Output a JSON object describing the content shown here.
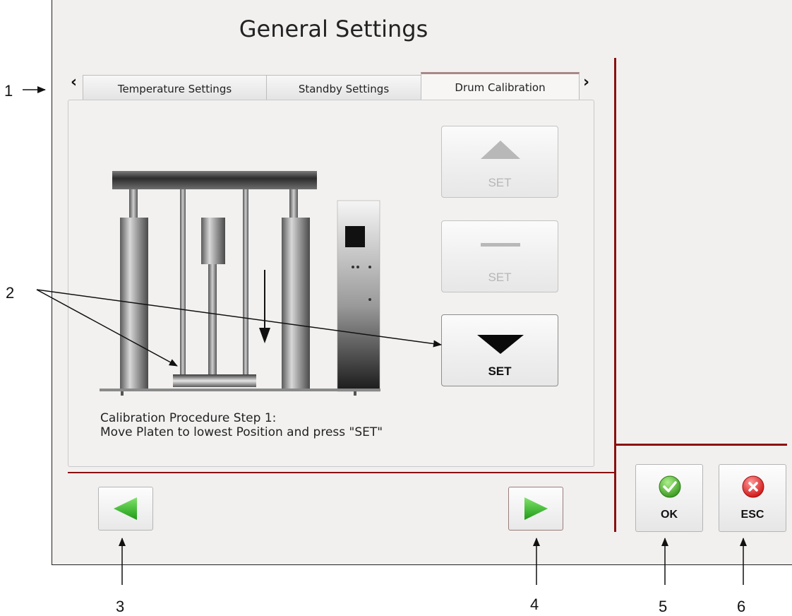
{
  "window": {
    "title": "General Settings"
  },
  "tabs": [
    {
      "label": "Temperature Settings",
      "active": false
    },
    {
      "label": "Standby Settings",
      "active": false
    },
    {
      "label": "Drum Calibration",
      "active": true
    }
  ],
  "set_buttons": {
    "up": {
      "label": "SET",
      "icon": "triangle-up-icon",
      "enabled": false
    },
    "middle": {
      "label": "SET",
      "icon": "minus-icon",
      "enabled": false
    },
    "down": {
      "label": "SET",
      "icon": "triangle-down-icon",
      "enabled": true
    }
  },
  "instruction": {
    "line1": "Calibration Procedure Step 1:",
    "line2": "Move Platen to lowest Position and press \"SET\""
  },
  "navigation": {
    "prev_icon": "arrow-left-icon",
    "next_icon": "arrow-right-icon"
  },
  "actions": {
    "ok": {
      "label": "OK",
      "icon": "check-circle-icon"
    },
    "esc": {
      "label": "ESC",
      "icon": "x-circle-icon"
    }
  },
  "callouts": [
    "1",
    "2",
    "3",
    "4",
    "5",
    "6"
  ],
  "colors": {
    "accent_line": "#8a1010",
    "ok_green": "#4caf3c",
    "esc_red": "#e02626",
    "nav_green": "#3fbf2b"
  }
}
